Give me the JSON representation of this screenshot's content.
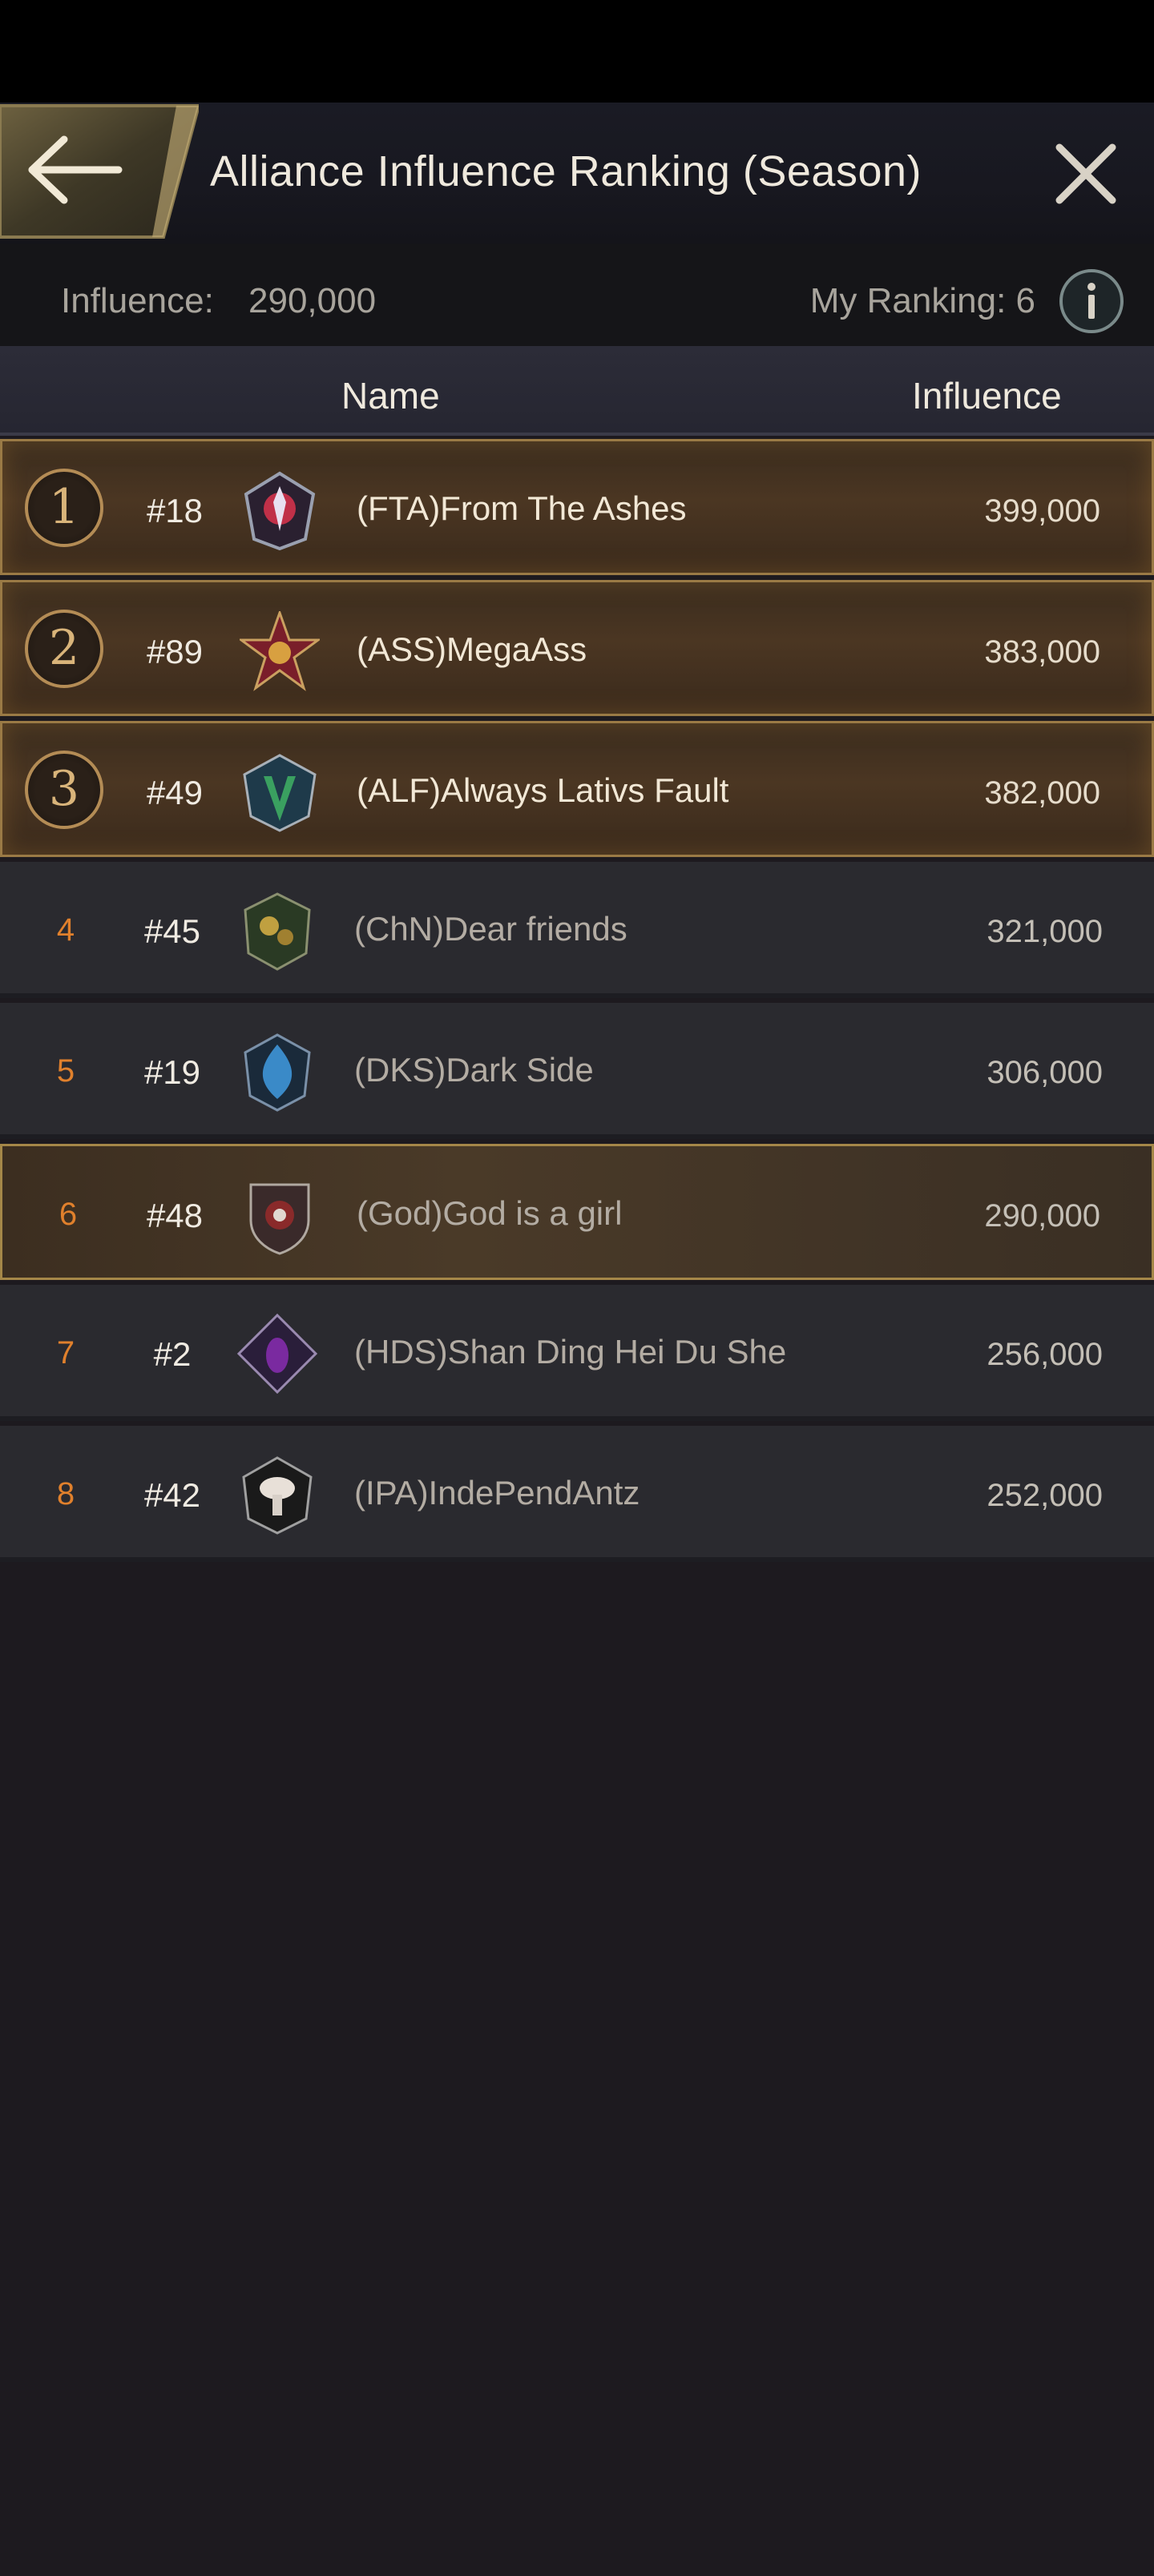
{
  "header": {
    "title": "Alliance Influence Ranking (Season)"
  },
  "info": {
    "influence_label": "Influence:",
    "influence_value": "290,000",
    "my_ranking": "My Ranking: 6"
  },
  "columns": {
    "name": "Name",
    "influence": "Influence"
  },
  "rows": [
    {
      "rank": "1",
      "server": "#18",
      "name": "(FTA)From The Ashes",
      "influence": "399,000",
      "crest_color": "#c03048"
    },
    {
      "rank": "2",
      "server": "#89",
      "name": "(ASS)MegaAss",
      "influence": "383,000",
      "crest_color": "#b8402a"
    },
    {
      "rank": "3",
      "server": "#49",
      "name": "(ALF)Always Lativs Fault",
      "influence": "382,000",
      "crest_color": "#2f7a52"
    },
    {
      "rank": "4",
      "server": "#45",
      "name": "(ChN)Dear friends",
      "influence": "321,000",
      "crest_color": "#3a6a38"
    },
    {
      "rank": "5",
      "server": "#19",
      "name": "(DKS)Dark Side",
      "influence": "306,000",
      "crest_color": "#2c6fa0"
    },
    {
      "rank": "6",
      "server": "#48",
      "name": "(God)God is a girl",
      "influence": "290,000",
      "crest_color": "#8a2a2a"
    },
    {
      "rank": "7",
      "server": "#2",
      "name": "(HDS)Shan Ding Hei Du She",
      "influence": "256,000",
      "crest_color": "#6a2a8a"
    },
    {
      "rank": "8",
      "server": "#42",
      "name": "(IPA)IndePendAntz",
      "influence": "252,000",
      "crest_color": "#2a2a2a"
    }
  ],
  "icons": {
    "back": "arrow-left-icon",
    "close": "close-icon",
    "info": "info-icon"
  },
  "colors": {
    "accent_gold": "#b48c55",
    "rank_orange": "#e0802c",
    "background": "#1d1a1f"
  }
}
